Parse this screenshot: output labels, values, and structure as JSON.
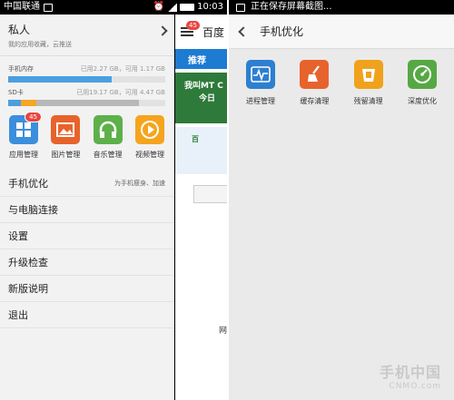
{
  "left_status": {
    "carrier": "中国联通",
    "time": "10:03",
    "battery": "91"
  },
  "right_status": {
    "text": "正在保存屏幕截图..."
  },
  "drawer": {
    "account": {
      "title": "私人",
      "subtitle": "我的应用收藏，云推送"
    },
    "storage": [
      {
        "label": "手机内存",
        "detail": "已用2.27 GB，可用 1.17 GB",
        "used_fraction": 0.66
      },
      {
        "label": "SD卡",
        "detail": "已用19.17 GB，可用 4.47 GB",
        "used_fraction": 0.81
      }
    ],
    "apps": [
      {
        "label": "应用管理",
        "badge": "45",
        "color": "#3b8fdc",
        "icon": "grid-icon"
      },
      {
        "label": "图片管理",
        "badge": "",
        "color": "#e8632b",
        "icon": "image-icon"
      },
      {
        "label": "音乐管理",
        "badge": "",
        "color": "#5db04a",
        "icon": "headphones-icon"
      },
      {
        "label": "视频管理",
        "badge": "",
        "color": "#f5a41d",
        "icon": "play-icon"
      }
    ],
    "menu": [
      {
        "label": "手机优化",
        "sub": "为手机瘦身、加速"
      },
      {
        "label": "与电脑连接",
        "sub": ""
      },
      {
        "label": "设置",
        "sub": ""
      },
      {
        "label": "升级检查",
        "sub": ""
      },
      {
        "label": "新版说明",
        "sub": ""
      },
      {
        "label": "退出",
        "sub": ""
      }
    ]
  },
  "peek": {
    "badge": "45",
    "title": "百度",
    "tab": "推荐",
    "banner1_l1": "我叫MT C",
    "banner1_l2": "今日",
    "banner2": "百",
    "net": "网"
  },
  "right": {
    "title": "手机优化",
    "tools": [
      {
        "label": "进程管理",
        "color": "#2e7fd0",
        "icon": "pulse-icon"
      },
      {
        "label": "缓存清理",
        "color": "#e7632d",
        "icon": "broom-icon"
      },
      {
        "label": "残留清理",
        "color": "#f0a21c",
        "icon": "truck-icon"
      },
      {
        "label": "深度优化",
        "color": "#56a844",
        "icon": "gauge-icon"
      }
    ],
    "watermark": {
      "cn": "手机中国",
      "en": "CNMO.com"
    }
  }
}
